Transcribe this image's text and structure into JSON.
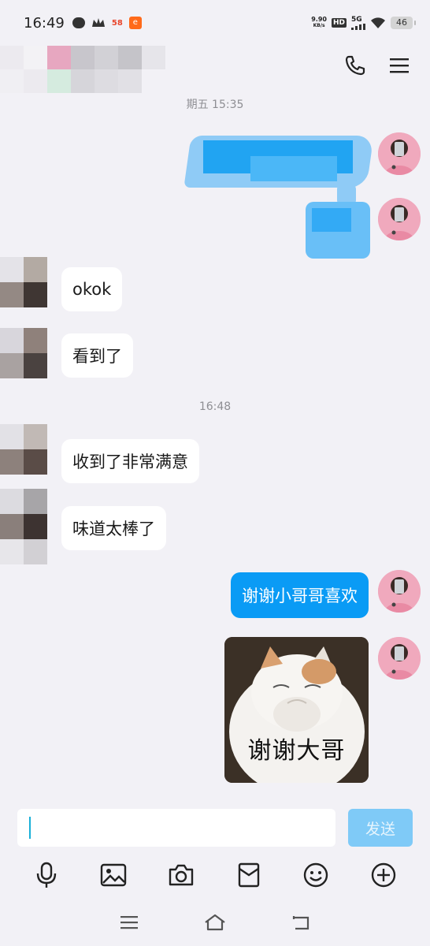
{
  "status_bar": {
    "time": "16:49",
    "speed_top": "9.90",
    "speed_bottom": "KB/s",
    "hd_badge": "HD",
    "network": "5G",
    "battery": "46",
    "app_58_label": "58"
  },
  "header": {
    "call_icon": "phone-icon",
    "menu_icon": "menu-icon"
  },
  "chat": {
    "time_top": "期五 15:35",
    "time_mid": "16:48",
    "messages": [
      {
        "side": "in",
        "text": "okok"
      },
      {
        "side": "in",
        "text": "看到了"
      },
      {
        "side": "in",
        "text": "收到了非常满意"
      },
      {
        "side": "in",
        "text": "味道太棒了"
      },
      {
        "side": "out",
        "text": "谢谢小哥哥喜欢"
      }
    ],
    "sticker_caption": "谢谢大哥"
  },
  "input": {
    "placeholder": "",
    "send_label": "发送"
  },
  "toolbar": [
    "microphone-icon",
    "image-icon",
    "camera-icon",
    "red-packet-icon",
    "emoji-icon",
    "plus-icon"
  ],
  "navbar": [
    "menu-nav-icon",
    "home-nav-icon",
    "back-nav-icon"
  ],
  "colors": {
    "background": "#f2f1f6",
    "bubble_out": "#0a9bf5",
    "bubble_in": "#ffffff",
    "send_button": "#7fcaf7"
  }
}
